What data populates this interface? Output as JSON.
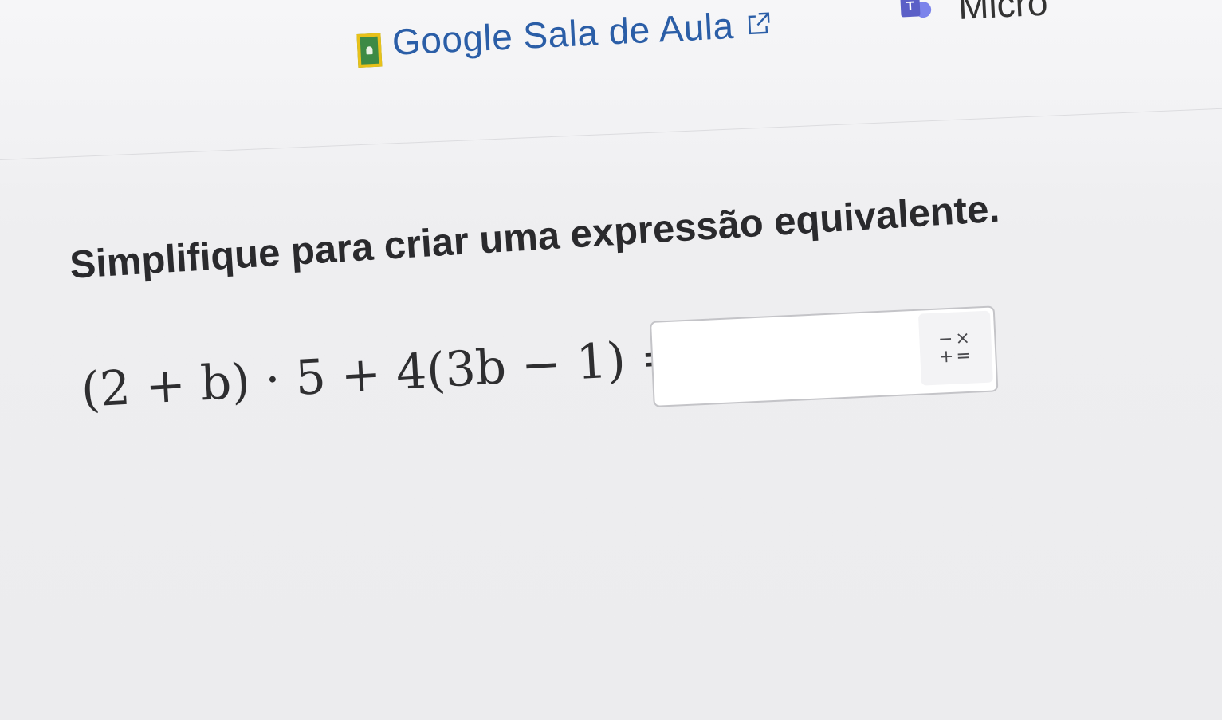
{
  "header": {
    "classroom_link_label": "Google Sala de Aula",
    "classroom_icon": "google-classroom-icon",
    "external_link_icon": "external-link-icon",
    "teams_label": "Micro",
    "teams_icon": "microsoft-teams-icon",
    "teams_icon_letter": "T"
  },
  "problem": {
    "instruction": "Simplifique para criar uma expressão equivalente.",
    "expression": "(2 + b) · 5 + 4(3b − 1) =",
    "answer_value": "",
    "keypad_icon": "math-keypad-icon",
    "keypad_top": "−×",
    "keypad_bottom": "+="
  },
  "colors": {
    "link": "#2b5ea7",
    "text": "#2a2a2d",
    "background": "#efeff1"
  }
}
